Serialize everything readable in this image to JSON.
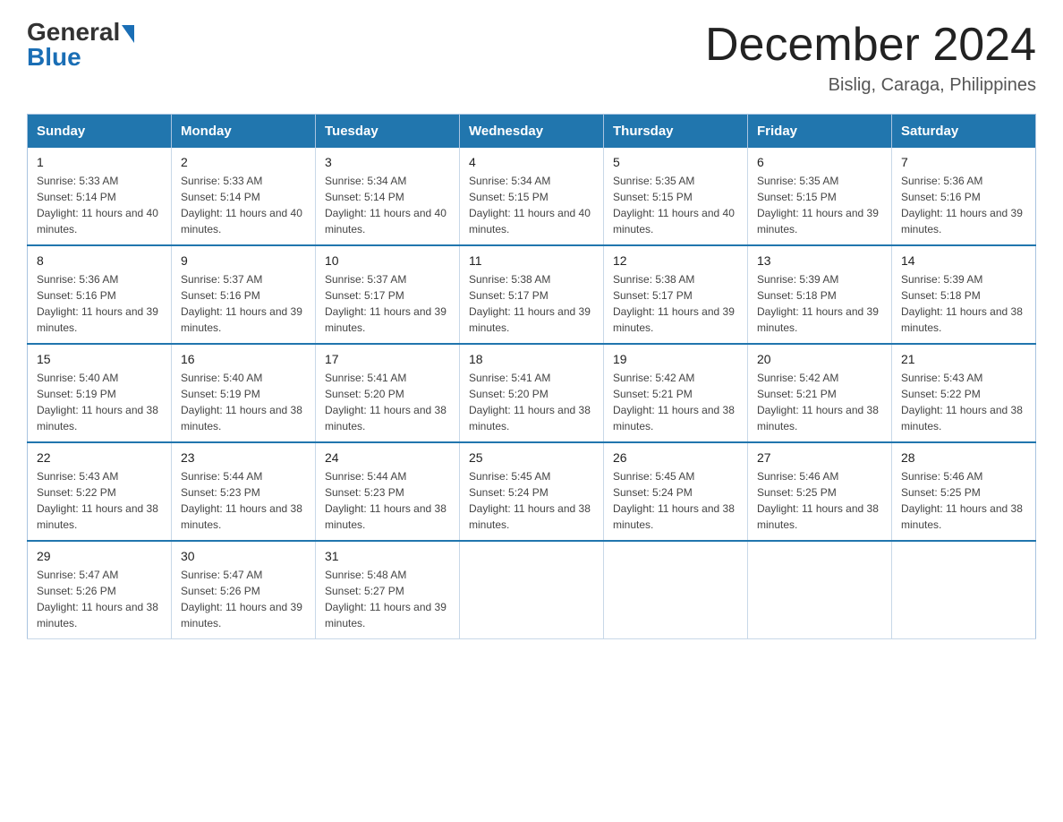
{
  "header": {
    "logo_general": "General",
    "logo_blue": "Blue",
    "month_title": "December 2024",
    "location": "Bislig, Caraga, Philippines"
  },
  "calendar": {
    "days_of_week": [
      "Sunday",
      "Monday",
      "Tuesday",
      "Wednesday",
      "Thursday",
      "Friday",
      "Saturday"
    ],
    "weeks": [
      [
        {
          "day": "1",
          "sunrise": "5:33 AM",
          "sunset": "5:14 PM",
          "daylight": "11 hours and 40 minutes."
        },
        {
          "day": "2",
          "sunrise": "5:33 AM",
          "sunset": "5:14 PM",
          "daylight": "11 hours and 40 minutes."
        },
        {
          "day": "3",
          "sunrise": "5:34 AM",
          "sunset": "5:14 PM",
          "daylight": "11 hours and 40 minutes."
        },
        {
          "day": "4",
          "sunrise": "5:34 AM",
          "sunset": "5:15 PM",
          "daylight": "11 hours and 40 minutes."
        },
        {
          "day": "5",
          "sunrise": "5:35 AM",
          "sunset": "5:15 PM",
          "daylight": "11 hours and 40 minutes."
        },
        {
          "day": "6",
          "sunrise": "5:35 AM",
          "sunset": "5:15 PM",
          "daylight": "11 hours and 39 minutes."
        },
        {
          "day": "7",
          "sunrise": "5:36 AM",
          "sunset": "5:16 PM",
          "daylight": "11 hours and 39 minutes."
        }
      ],
      [
        {
          "day": "8",
          "sunrise": "5:36 AM",
          "sunset": "5:16 PM",
          "daylight": "11 hours and 39 minutes."
        },
        {
          "day": "9",
          "sunrise": "5:37 AM",
          "sunset": "5:16 PM",
          "daylight": "11 hours and 39 minutes."
        },
        {
          "day": "10",
          "sunrise": "5:37 AM",
          "sunset": "5:17 PM",
          "daylight": "11 hours and 39 minutes."
        },
        {
          "day": "11",
          "sunrise": "5:38 AM",
          "sunset": "5:17 PM",
          "daylight": "11 hours and 39 minutes."
        },
        {
          "day": "12",
          "sunrise": "5:38 AM",
          "sunset": "5:17 PM",
          "daylight": "11 hours and 39 minutes."
        },
        {
          "day": "13",
          "sunrise": "5:39 AM",
          "sunset": "5:18 PM",
          "daylight": "11 hours and 39 minutes."
        },
        {
          "day": "14",
          "sunrise": "5:39 AM",
          "sunset": "5:18 PM",
          "daylight": "11 hours and 38 minutes."
        }
      ],
      [
        {
          "day": "15",
          "sunrise": "5:40 AM",
          "sunset": "5:19 PM",
          "daylight": "11 hours and 38 minutes."
        },
        {
          "day": "16",
          "sunrise": "5:40 AM",
          "sunset": "5:19 PM",
          "daylight": "11 hours and 38 minutes."
        },
        {
          "day": "17",
          "sunrise": "5:41 AM",
          "sunset": "5:20 PM",
          "daylight": "11 hours and 38 minutes."
        },
        {
          "day": "18",
          "sunrise": "5:41 AM",
          "sunset": "5:20 PM",
          "daylight": "11 hours and 38 minutes."
        },
        {
          "day": "19",
          "sunrise": "5:42 AM",
          "sunset": "5:21 PM",
          "daylight": "11 hours and 38 minutes."
        },
        {
          "day": "20",
          "sunrise": "5:42 AM",
          "sunset": "5:21 PM",
          "daylight": "11 hours and 38 minutes."
        },
        {
          "day": "21",
          "sunrise": "5:43 AM",
          "sunset": "5:22 PM",
          "daylight": "11 hours and 38 minutes."
        }
      ],
      [
        {
          "day": "22",
          "sunrise": "5:43 AM",
          "sunset": "5:22 PM",
          "daylight": "11 hours and 38 minutes."
        },
        {
          "day": "23",
          "sunrise": "5:44 AM",
          "sunset": "5:23 PM",
          "daylight": "11 hours and 38 minutes."
        },
        {
          "day": "24",
          "sunrise": "5:44 AM",
          "sunset": "5:23 PM",
          "daylight": "11 hours and 38 minutes."
        },
        {
          "day": "25",
          "sunrise": "5:45 AM",
          "sunset": "5:24 PM",
          "daylight": "11 hours and 38 minutes."
        },
        {
          "day": "26",
          "sunrise": "5:45 AM",
          "sunset": "5:24 PM",
          "daylight": "11 hours and 38 minutes."
        },
        {
          "day": "27",
          "sunrise": "5:46 AM",
          "sunset": "5:25 PM",
          "daylight": "11 hours and 38 minutes."
        },
        {
          "day": "28",
          "sunrise": "5:46 AM",
          "sunset": "5:25 PM",
          "daylight": "11 hours and 38 minutes."
        }
      ],
      [
        {
          "day": "29",
          "sunrise": "5:47 AM",
          "sunset": "5:26 PM",
          "daylight": "11 hours and 38 minutes."
        },
        {
          "day": "30",
          "sunrise": "5:47 AM",
          "sunset": "5:26 PM",
          "daylight": "11 hours and 39 minutes."
        },
        {
          "day": "31",
          "sunrise": "5:48 AM",
          "sunset": "5:27 PM",
          "daylight": "11 hours and 39 minutes."
        },
        null,
        null,
        null,
        null
      ]
    ]
  }
}
